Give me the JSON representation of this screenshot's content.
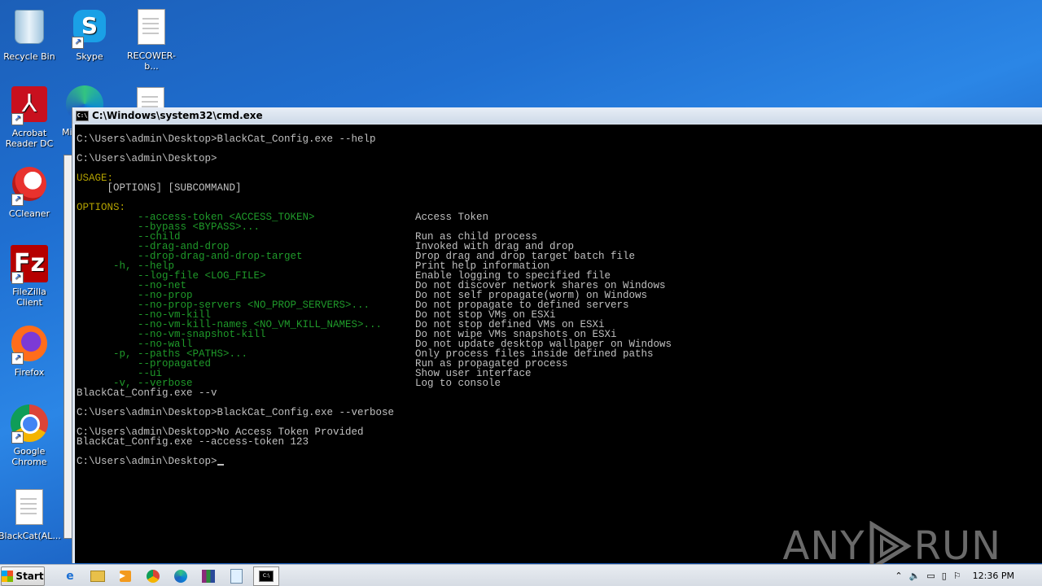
{
  "desktop": {
    "icons": [
      {
        "label": "Recycle Bin"
      },
      {
        "label": "Skype"
      },
      {
        "label": "RECOWER-b..."
      },
      {
        "label": "Acrobat Reader DC"
      },
      {
        "label": "Mi"
      },
      {
        "label": "CCleaner"
      },
      {
        "label": "FileZilla Client"
      },
      {
        "label": "Firefox"
      },
      {
        "label": "Google Chrome"
      },
      {
        "label": "BlackCat(AL..."
      }
    ]
  },
  "cmd": {
    "title": "C:\\Windows\\system32\\cmd.exe",
    "lines": [
      {
        "text": "C:\\Users\\admin\\Desktop>BlackCat_Config.exe --help",
        "color": "w"
      },
      {
        "text": "",
        "color": "w"
      },
      {
        "text": "C:\\Users\\admin\\Desktop>",
        "color": "w"
      },
      {
        "text": "",
        "color": "w"
      },
      {
        "text": "USAGE:",
        "color": "y"
      },
      {
        "text": "     [OPTIONS] [SUBCOMMAND]",
        "color": "w"
      },
      {
        "text": "",
        "color": "w"
      },
      {
        "text": "OPTIONS:",
        "color": "y"
      },
      {
        "text": "          --access-token <ACCESS_TOKEN>",
        "color": "g",
        "desc": "Access Token"
      },
      {
        "text": "          --bypass <BYPASS>...",
        "color": "g",
        "desc": ""
      },
      {
        "text": "          --child",
        "color": "g",
        "desc": "Run as child process"
      },
      {
        "text": "          --drag-and-drop",
        "color": "g",
        "desc": "Invoked with drag and drop"
      },
      {
        "text": "          --drop-drag-and-drop-target",
        "color": "g",
        "desc": "Drop drag and drop target batch file"
      },
      {
        "text": "      -h, --help",
        "color": "g",
        "desc": "Print help information"
      },
      {
        "text": "          --log-file <LOG_FILE>",
        "color": "g",
        "desc": "Enable logging to specified file"
      },
      {
        "text": "          --no-net",
        "color": "g",
        "desc": "Do not discover network shares on Windows"
      },
      {
        "text": "          --no-prop",
        "color": "g",
        "desc": "Do not self propagate(worm) on Windows"
      },
      {
        "text": "          --no-prop-servers <NO_PROP_SERVERS>...",
        "color": "g",
        "desc": "Do not propagate to defined servers"
      },
      {
        "text": "          --no-vm-kill",
        "color": "g",
        "desc": "Do not stop VMs on ESXi"
      },
      {
        "text": "          --no-vm-kill-names <NO_VM_KILL_NAMES>...",
        "color": "g",
        "desc": "Do not stop defined VMs on ESXi"
      },
      {
        "text": "          --no-vm-snapshot-kill",
        "color": "g",
        "desc": "Do not wipe VMs snapshots on ESXi"
      },
      {
        "text": "          --no-wall",
        "color": "g",
        "desc": "Do not update desktop wallpaper on Windows"
      },
      {
        "text": "      -p, --paths <PATHS>...",
        "color": "g",
        "desc": "Only process files inside defined paths"
      },
      {
        "text": "          --propagated",
        "color": "g",
        "desc": "Run as propagated process"
      },
      {
        "text": "          --ui",
        "color": "g",
        "desc": "Show user interface"
      },
      {
        "text": "      -v, --verbose",
        "color": "g",
        "desc": "Log to console"
      },
      {
        "text": "BlackCat_Config.exe --v",
        "color": "w"
      },
      {
        "text": "",
        "color": "w"
      },
      {
        "text": "C:\\Users\\admin\\Desktop>BlackCat_Config.exe --verbose",
        "color": "w"
      },
      {
        "text": "",
        "color": "w"
      },
      {
        "text": "C:\\Users\\admin\\Desktop>No Access Token Provided",
        "color": "w"
      },
      {
        "text": "BlackCat_Config.exe --access-token 123",
        "color": "w"
      },
      {
        "text": "",
        "color": "w"
      }
    ],
    "prompt": "C:\\Users\\admin\\Desktop>"
  },
  "watermark": {
    "left": "ANY",
    "right": "RUN"
  },
  "taskbar": {
    "start_label": "Start",
    "clock": "12:36 PM"
  }
}
